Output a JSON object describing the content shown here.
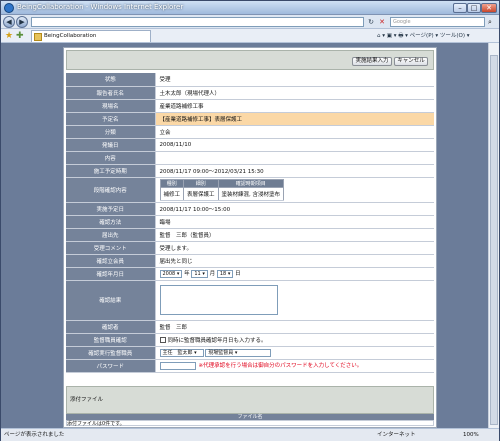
{
  "window": {
    "title": "BeingCollaboration - Windows Internet Explorer"
  },
  "browser": {
    "search_placeholder": "Google",
    "tab_title": "BeingCollaboration",
    "tools_text": "⌂ ▾ ▣ ▾ 🖶 ▾ ページ(P) ▾ ツール(O) ▾",
    "status": "ページが表示されました",
    "zone": "インターネット",
    "zoom": "100%"
  },
  "toolbar": {
    "confirm": "実施結果入力",
    "cancel": "キャンセル"
  },
  "form": {
    "rows": [
      {
        "label": "状態",
        "value": "受理"
      },
      {
        "label": "報告者氏名",
        "value": "土木太郎（現場代理人）"
      },
      {
        "label": "現場名",
        "value": "産業道路補修工事"
      },
      {
        "label": "予定名",
        "value": "【産業道路補修工事】表層保護工"
      },
      {
        "label": "分類",
        "value": "立会"
      },
      {
        "label": "発議日",
        "value": "2008/11/10"
      },
      {
        "label": "内容",
        "value": ""
      },
      {
        "label": "施工予定時期",
        "value": "2008/11/17 09:00～2012/03/21 15:30"
      }
    ],
    "detail": {
      "label": "段階確認内容",
      "headers": [
        "種別",
        "細別",
        "確認時期項目"
      ],
      "row": [
        "補修工",
        "表層保護工",
        "塗装材練混, 含浸材塗布"
      ]
    },
    "rows2": [
      {
        "label": "実施予定日",
        "value": "2008/11/17 10:00～15:00"
      },
      {
        "label": "確認方法",
        "value": "臨場"
      },
      {
        "label": "届出先",
        "value": "監督　三郎（監督員）"
      },
      {
        "label": "受理コメント",
        "value": "受理します。"
      },
      {
        "label": "確認立会員",
        "value": "届出先と同じ"
      }
    ],
    "date": {
      "label": "確認年月日",
      "year": "2008",
      "y": "年",
      "month": "11",
      "m": "月",
      "day": "18",
      "d": "日"
    },
    "result": {
      "label": "確認結果"
    },
    "confirmer": {
      "label": "確認者",
      "value": "監督　三郎"
    },
    "supervisor_check": {
      "label": "監督職員確認",
      "text": "同時に監督職員確認年月日も入力する。"
    },
    "executor": {
      "label": "確認実行監督職員",
      "role": "主任　監太郎",
      "person": "現場監督員"
    },
    "password": {
      "label": "パスワード",
      "warning": "※代理承認を行う場合は御自分のパスワードを入力してください。"
    }
  },
  "attachments": {
    "title": "添付ファイル",
    "column": "ファイル名",
    "none": "添付ファイルは0件です。"
  }
}
